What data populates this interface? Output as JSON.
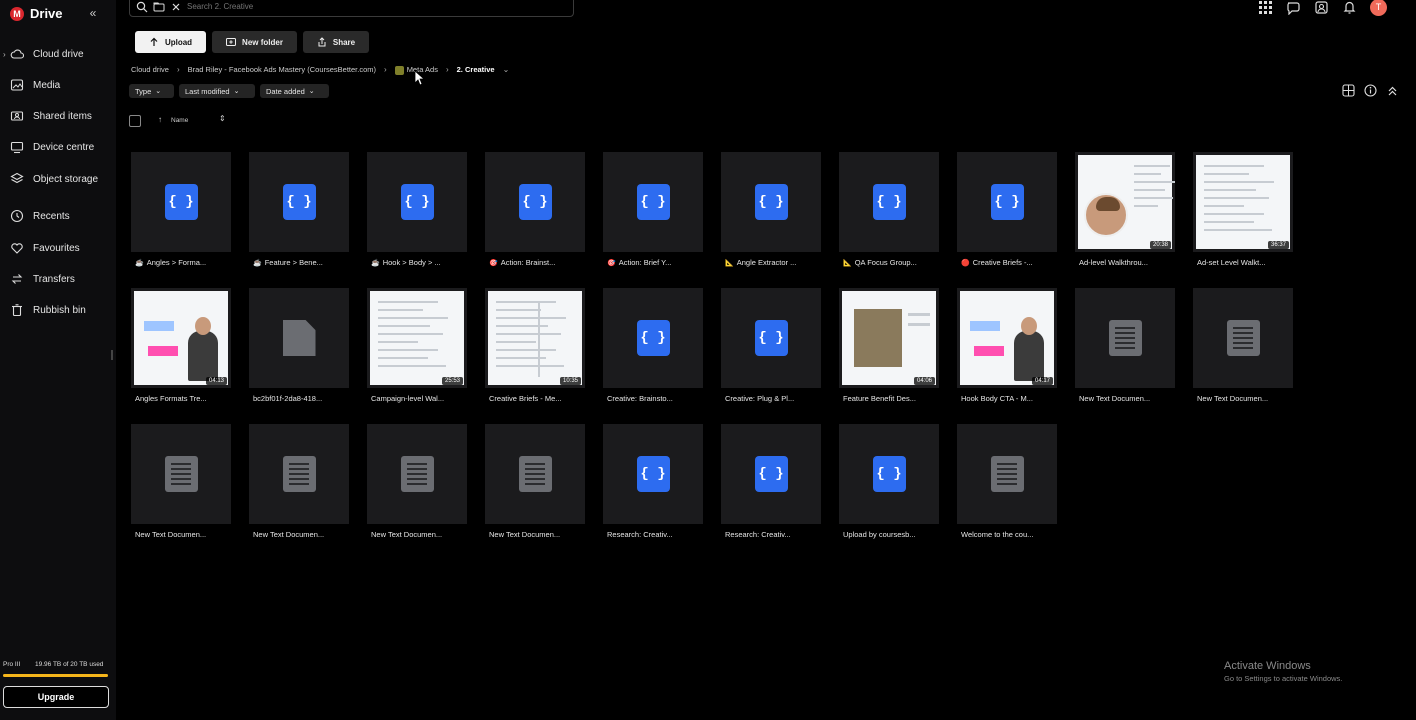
{
  "app": {
    "name": "Drive",
    "logo_letter": "M"
  },
  "sidebar": {
    "items": [
      {
        "label": "Cloud drive",
        "icon": "cloud-icon"
      },
      {
        "label": "Media",
        "icon": "image-icon"
      },
      {
        "label": "Shared items",
        "icon": "shared-icon"
      },
      {
        "label": "Device centre",
        "icon": "device-icon"
      },
      {
        "label": "Object storage",
        "icon": "storage-icon"
      },
      {
        "label": "Recents",
        "icon": "clock-icon"
      },
      {
        "label": "Favourites",
        "icon": "heart-icon"
      },
      {
        "label": "Transfers",
        "icon": "transfers-icon"
      },
      {
        "label": "Rubbish bin",
        "icon": "trash-icon"
      }
    ],
    "plan": "Pro III",
    "storage_text": "19.96 TB of 20 TB used",
    "storage_fraction": 0.998,
    "upgrade_label": "Upgrade"
  },
  "search": {
    "placeholder": "Search 2. Creative"
  },
  "user": {
    "avatar_letter": "T"
  },
  "actions": {
    "upload": "Upload",
    "new_folder": "New folder",
    "share": "Share"
  },
  "breadcrumb": [
    "Cloud drive",
    "Brad Riley - Facebook Ads Mastery (CoursesBetter.com)",
    "Meta Ads",
    "2. Creative"
  ],
  "filters": [
    "Type",
    "Last modified",
    "Date added"
  ],
  "list_header": {
    "name": "Name"
  },
  "files": [
    {
      "name": "Angles > Forma...",
      "kind": "code",
      "prefix": "☕"
    },
    {
      "name": "Feature > Bene...",
      "kind": "code",
      "prefix": "☕"
    },
    {
      "name": "Hook > Body > ...",
      "kind": "code",
      "prefix": "☕"
    },
    {
      "name": "Action:  Brainst...",
      "kind": "code",
      "prefix": "🎯"
    },
    {
      "name": "Action:  Brief Y...",
      "kind": "code",
      "prefix": "🎯"
    },
    {
      "name": "Angle Extractor ...",
      "kind": "code",
      "prefix": "📐"
    },
    {
      "name": "QA Focus Group...",
      "kind": "code",
      "prefix": "📐"
    },
    {
      "name": "Creative Briefs -...",
      "kind": "code",
      "prefix": "🔴"
    },
    {
      "name": "Ad-level Walkthrou...",
      "kind": "video",
      "duration": "20:38",
      "style": "face"
    },
    {
      "name": "Ad-set Level Walkt...",
      "kind": "video",
      "duration": "36:37",
      "style": "doc"
    },
    {
      "name": "Angles Formats Tre...",
      "kind": "video",
      "duration": "04:13",
      "style": "board"
    },
    {
      "name": "bc2bf01f-2da8-418...",
      "kind": "generic"
    },
    {
      "name": "Campaign-level Wal...",
      "kind": "video",
      "duration": "25:53",
      "style": "doc"
    },
    {
      "name": "Creative Briefs - Me...",
      "kind": "video",
      "duration": "10:35",
      "style": "sheet"
    },
    {
      "name": "Creative:  Brainsto...",
      "kind": "code"
    },
    {
      "name": "Creative:  Plug & Pl...",
      "kind": "code"
    },
    {
      "name": "Feature Benefit Des...",
      "kind": "video",
      "duration": "04:06",
      "style": "phone"
    },
    {
      "name": "Hook Body CTA - M...",
      "kind": "video",
      "duration": "04:17",
      "style": "board"
    },
    {
      "name": "New Text Documen...",
      "kind": "text"
    },
    {
      "name": "New Text Documen...",
      "kind": "text"
    },
    {
      "name": "New Text Documen...",
      "kind": "text"
    },
    {
      "name": "New Text Documen...",
      "kind": "text"
    },
    {
      "name": "New Text Documen...",
      "kind": "text"
    },
    {
      "name": "New Text Documen...",
      "kind": "text"
    },
    {
      "name": "Research:  Creativ...",
      "kind": "code"
    },
    {
      "name": "Research:  Creativ...",
      "kind": "code"
    },
    {
      "name": "Upload by coursesb...",
      "kind": "code"
    },
    {
      "name": "Welcome to the cou...",
      "kind": "text"
    }
  ],
  "os_notice": {
    "title": "Activate Windows",
    "subtitle": "Go to Settings to activate Windows."
  },
  "colors": {
    "accent": "#d9272e",
    "code_icon": "#2d6cf0",
    "storage_bar": "#f5b51b"
  }
}
